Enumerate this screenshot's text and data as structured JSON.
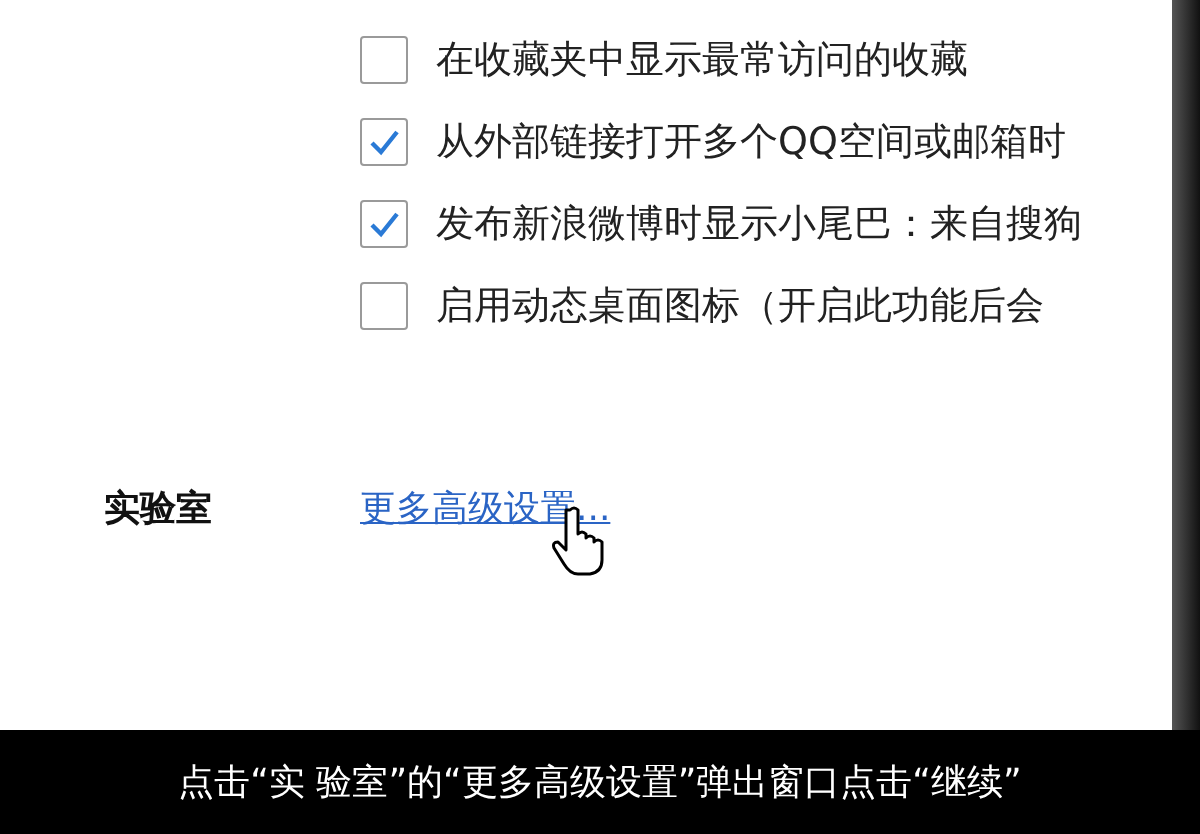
{
  "options": [
    {
      "label": "在收藏夹中显示最常访问的收藏",
      "checked": false
    },
    {
      "label": "从外部链接打开多个QQ空间或邮箱时",
      "checked": true
    },
    {
      "label": "发布新浪微博时显示小尾巴：来自搜狗",
      "checked": true
    },
    {
      "label": "启用动态桌面图标（开启此功能后会",
      "checked": false
    }
  ],
  "lab": {
    "label": "实验室",
    "link": "更多高级设置..."
  },
  "subtitle": "点击“实 验室”的“更多高级设置”弹出窗口点击“继续”"
}
